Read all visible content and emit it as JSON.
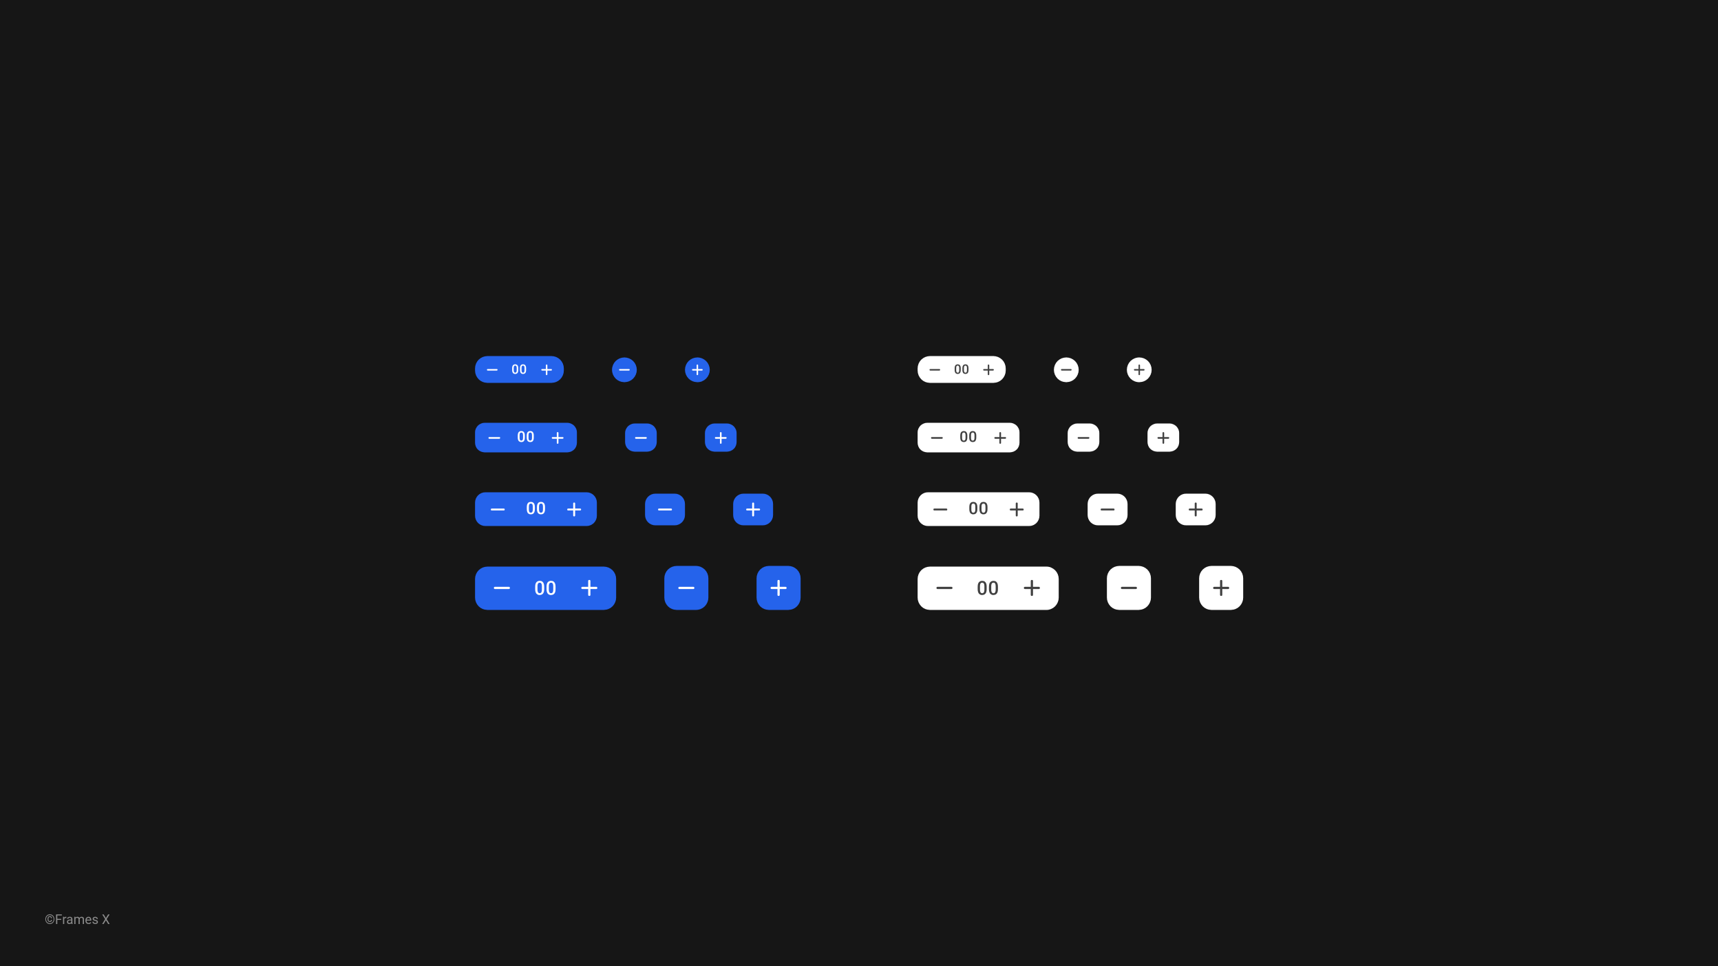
{
  "colors": {
    "accent": "#2563eb",
    "surface": "#ffffff",
    "bg": "#161616"
  },
  "value": "00",
  "credit": "©Frames X",
  "icons": {
    "minus": "minus-icon",
    "plus": "plus-icon"
  }
}
